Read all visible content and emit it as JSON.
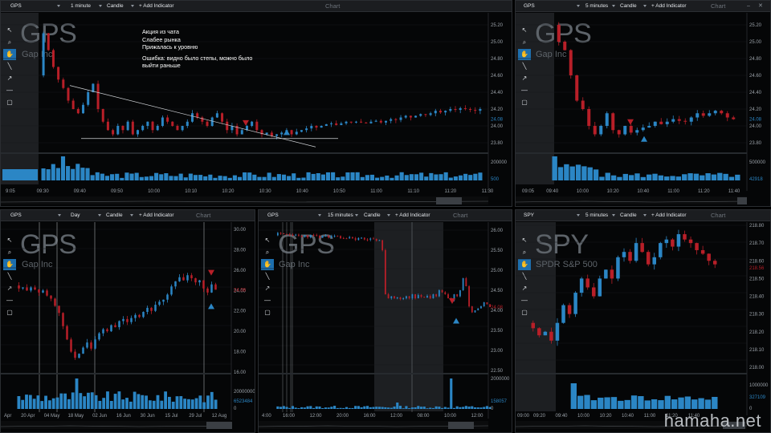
{
  "colors": {
    "up": "#2b86c5",
    "down": "#b81f28",
    "panel_bg": "#050607",
    "toolbar_bg": "#1b1d20",
    "accent": "#1d6fae"
  },
  "toolbar": {
    "add_indicator": "+ Add Indicator",
    "chart_label": "Chart"
  },
  "tools": [
    "cursor-icon",
    "zoom-icon",
    "hand-icon",
    "line-icon",
    "arrow-icon",
    "hline-icon",
    "rectangle-icon"
  ],
  "annotation": {
    "lines": [
      "Акция из чата",
      "Слабее рынка",
      "Прижалась к уровню",
      "Ошибка: видно было степы, можно было",
      "выйти раньше"
    ]
  },
  "watermark": "hamaha.net",
  "panels": [
    {
      "id": "p1",
      "symbol": "GPS",
      "name": "Gap Inc",
      "interval": "1 minute",
      "type": "Candle",
      "price_labels": [
        "25.20",
        "25.00",
        "24.80",
        "24.60",
        "24.40",
        "24.20",
        "24.08",
        "24.00",
        "23.80"
      ],
      "price_values": [
        25.2,
        25.0,
        24.8,
        24.6,
        24.4,
        24.2,
        24.08,
        24.0,
        23.8
      ],
      "price_current": "24.08",
      "volume_labels": [
        "200000",
        "500"
      ],
      "time_labels": [
        "9:05",
        "09:30",
        "09:40",
        "09:50",
        "10:00",
        "10:10",
        "10:20",
        "10:30",
        "10:40",
        "10:50",
        "11:00",
        "11:10",
        "11:20",
        "11:30"
      ]
    },
    {
      "id": "p2",
      "symbol": "GPS",
      "name": "Gap Inc",
      "interval": "5 minutes",
      "type": "Candle",
      "price_labels": [
        "25.20",
        "25.00",
        "24.80",
        "24.60",
        "24.40",
        "24.20",
        "24.08",
        "24.00",
        "23.80"
      ],
      "price_values": [
        25.2,
        25.0,
        24.8,
        24.6,
        24.4,
        24.2,
        24.08,
        24.0,
        23.8
      ],
      "price_current": "24.08",
      "volume_labels": [
        "500000",
        "42918"
      ],
      "time_labels": [
        "09:05",
        "09:40",
        "10:00",
        "10:20",
        "10:40",
        "11:00",
        "11:20",
        "11:40"
      ]
    },
    {
      "id": "p3",
      "symbol": "GPS",
      "name": "Gap Inc",
      "interval": "Day",
      "type": "Candle",
      "price_labels": [
        "30.00",
        "28.00",
        "26.00",
        "24.00",
        "24.08",
        "22.00",
        "20.00",
        "18.00",
        "16.00"
      ],
      "price_values": [
        30,
        28,
        26,
        24.0,
        24.08,
        22,
        20,
        18,
        16
      ],
      "price_current": "24.08",
      "volume_labels": [
        "20000000",
        "6523484",
        "0"
      ],
      "time_labels": [
        "Apr",
        "20 Apr",
        "04 May",
        "18 May",
        "02 Jun",
        "16 Jun",
        "30 Jun",
        "15 Jul",
        "29 Jul",
        "12 Aug"
      ]
    },
    {
      "id": "p4",
      "symbol": "GPS",
      "name": "Gap Inc",
      "interval": "15 minutes",
      "type": "Candle",
      "price_labels": [
        "26.00",
        "25.50",
        "25.00",
        "24.50",
        "24.08",
        "24.00",
        "23.50",
        "23.00",
        "22.50"
      ],
      "price_values": [
        26,
        25.5,
        25,
        24.5,
        24.08,
        24.0,
        23.5,
        23,
        22.5
      ],
      "price_current": "24.08",
      "volume_labels": [
        "2000000",
        "158057",
        "0"
      ],
      "time_labels": [
        "4:00",
        "16:00",
        "12:00",
        "20:00",
        "16:00",
        "12:00",
        "08:00",
        "10:00",
        "12:00"
      ]
    },
    {
      "id": "p5",
      "symbol": "SPY",
      "name": "SPDR S&P 500",
      "interval": "5 minutes",
      "type": "Candle",
      "price_labels": [
        "218.80",
        "218.70",
        "218.60",
        "218.56",
        "218.50",
        "218.40",
        "218.30",
        "218.20",
        "218.10",
        "218.00"
      ],
      "price_values": [
        218.8,
        218.7,
        218.6,
        218.56,
        218.5,
        218.4,
        218.3,
        218.2,
        218.1,
        218.0
      ],
      "price_current": "218.56",
      "volume_labels": [
        "1000000",
        "327109",
        "0"
      ],
      "time_labels": [
        "09:00",
        "09:20",
        "09:40",
        "10:00",
        "10:20",
        "10:40",
        "11:00",
        "11:20",
        "11:40"
      ]
    }
  ]
}
